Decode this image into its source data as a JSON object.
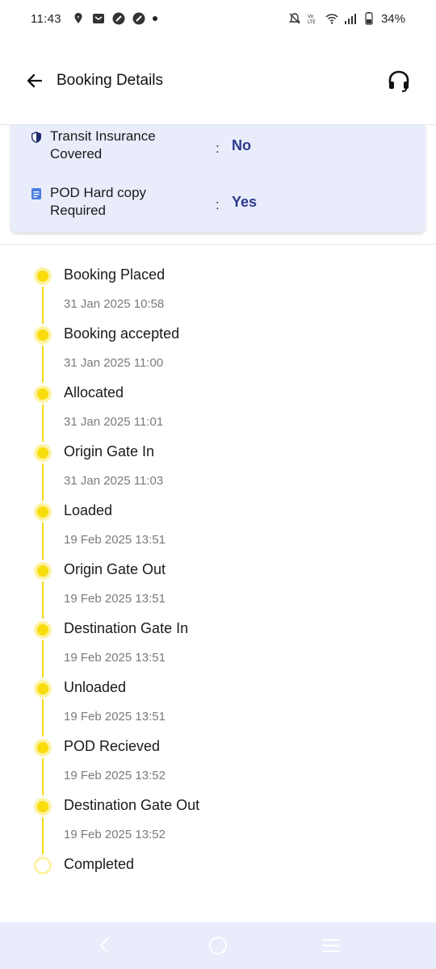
{
  "status_bar": {
    "time": "11:43",
    "battery": "34%",
    "network": "LTE"
  },
  "app_bar": {
    "title": "Booking Details"
  },
  "info": [
    {
      "icon": "shield-icon",
      "label": "Transit Insurance Covered",
      "colon": ":",
      "value": "No"
    },
    {
      "icon": "document-icon",
      "label": "POD Hard copy Required",
      "colon": ":",
      "value": "Yes"
    }
  ],
  "timeline": [
    {
      "title": "Booking Placed",
      "time": "31 Jan 2025 10:58",
      "done": true
    },
    {
      "title": "Booking accepted",
      "time": "31 Jan 2025 11:00",
      "done": true
    },
    {
      "title": "Allocated",
      "time": "31 Jan 2025 11:01",
      "done": true
    },
    {
      "title": "Origin Gate In",
      "time": "31 Jan 2025 11:03",
      "done": true
    },
    {
      "title": "Loaded",
      "time": "19 Feb 2025 13:51",
      "done": true
    },
    {
      "title": "Origin Gate Out",
      "time": "19 Feb 2025 13:51",
      "done": true
    },
    {
      "title": "Destination Gate In",
      "time": "19 Feb 2025 13:51",
      "done": true
    },
    {
      "title": "Unloaded",
      "time": "19 Feb 2025 13:51",
      "done": true
    },
    {
      "title": "POD Recieved",
      "time": "19 Feb 2025 13:52",
      "done": true
    },
    {
      "title": "Destination Gate Out",
      "time": "19 Feb 2025 13:52",
      "done": true
    },
    {
      "title": "Completed",
      "time": "",
      "done": false
    }
  ],
  "colors": {
    "accent_yellow": "#f9dc0c",
    "card_bg": "#e9ecfb",
    "value_blue": "#2c3a8c"
  }
}
